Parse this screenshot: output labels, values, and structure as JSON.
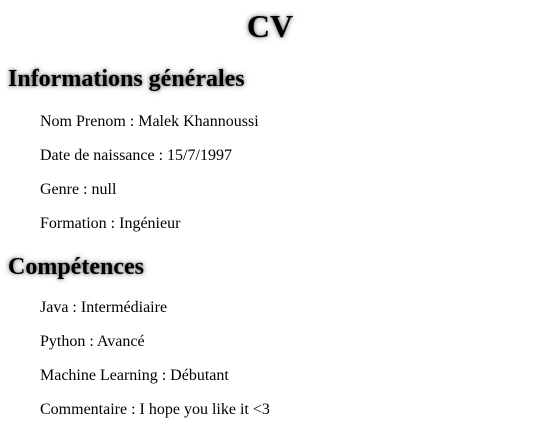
{
  "page": {
    "title": "CV"
  },
  "general": {
    "heading": "Informations générales",
    "items": [
      "Nom Prenom : Malek Khannoussi",
      "Date de naissance : 15/7/1997",
      "Genre : null",
      "Formation : Ingénieur"
    ]
  },
  "skills": {
    "heading": "Compétences",
    "items": [
      "Java : Intermédiaire",
      "Python : Avancé",
      "Machine Learning : Débutant",
      "Commentaire : I hope you like it <3"
    ]
  }
}
